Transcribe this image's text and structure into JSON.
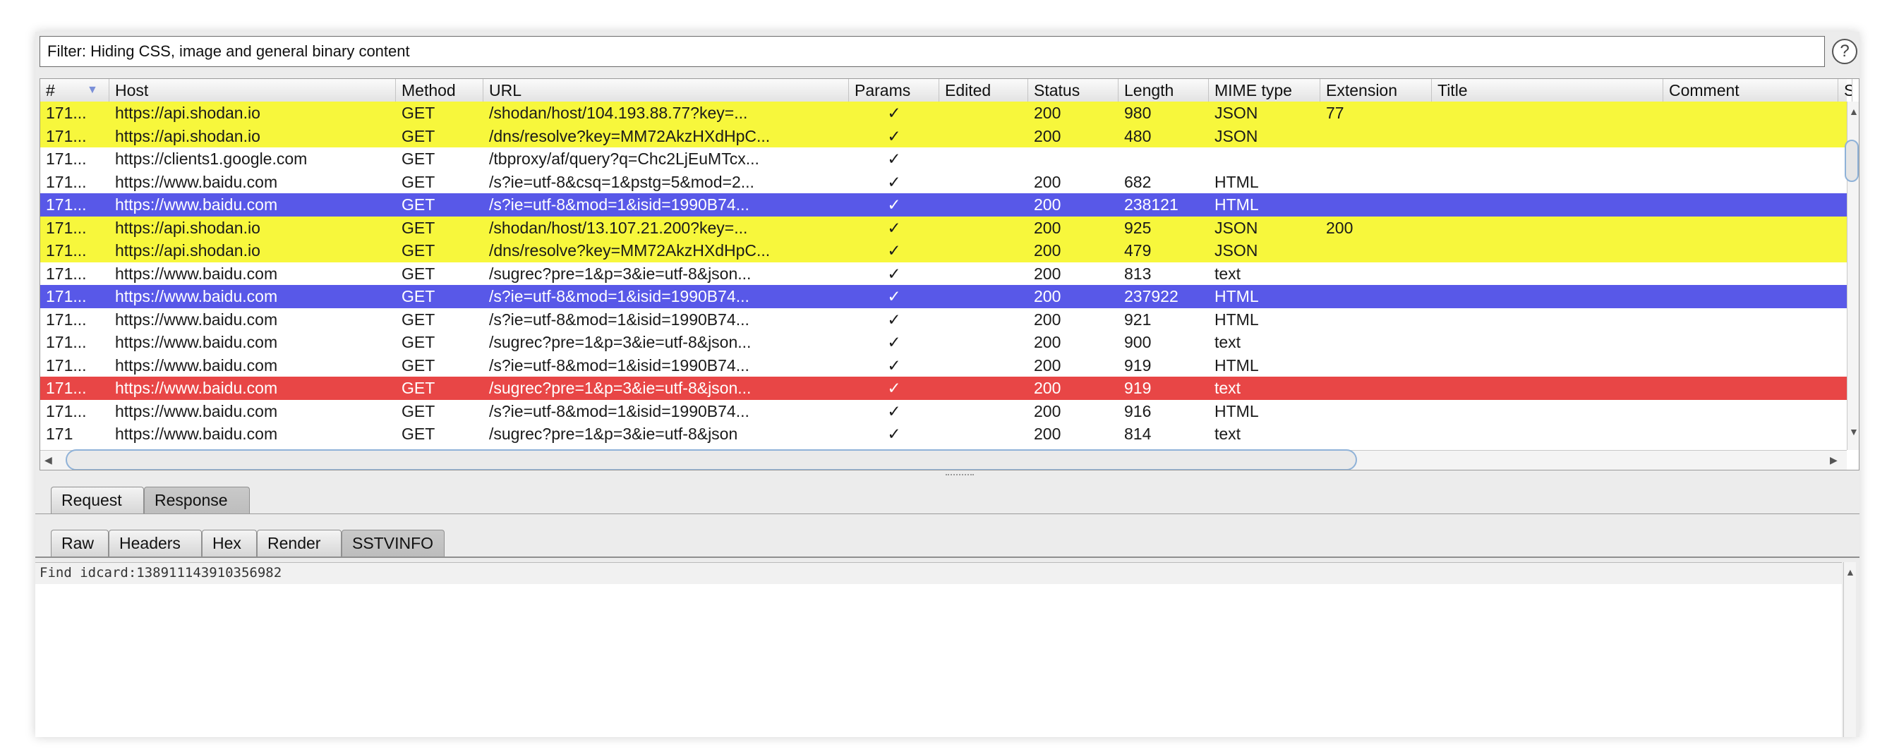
{
  "filter": {
    "text": "Filter: Hiding CSS, image and general binary content",
    "help_glyph": "?"
  },
  "columns": [
    "#",
    "Host",
    "Method",
    "URL",
    "Params",
    "Edited",
    "Status",
    "Length",
    "MIME type",
    "Extension",
    "Title",
    "Comment",
    "S"
  ],
  "check_glyph": "✓",
  "rows": [
    {
      "color": "yellow",
      "num": "171...",
      "host": "https://api.shodan.io",
      "method": "GET",
      "url": "/shodan/host/104.193.88.77?key=...",
      "params": "✓",
      "edited": "",
      "status": "200",
      "length": "980",
      "mime": "JSON",
      "ext": "77",
      "title": "",
      "comment": ""
    },
    {
      "color": "yellow",
      "num": "171...",
      "host": "https://api.shodan.io",
      "method": "GET",
      "url": "/dns/resolve?key=MM72AkzHXdHpC...",
      "params": "✓",
      "edited": "",
      "status": "200",
      "length": "480",
      "mime": "JSON",
      "ext": "",
      "title": "",
      "comment": ""
    },
    {
      "color": "white",
      "num": "171...",
      "host": "https://clients1.google.com",
      "method": "GET",
      "url": "/tbproxy/af/query?q=Chc2LjEuMTcx...",
      "params": "✓",
      "edited": "",
      "status": "",
      "length": "",
      "mime": "",
      "ext": "",
      "title": "",
      "comment": ""
    },
    {
      "color": "white",
      "num": "171...",
      "host": "https://www.baidu.com",
      "method": "GET",
      "url": "/s?ie=utf-8&csq=1&pstg=5&mod=2...",
      "params": "✓",
      "edited": "",
      "status": "200",
      "length": "682",
      "mime": "HTML",
      "ext": "",
      "title": "",
      "comment": ""
    },
    {
      "color": "blue",
      "num": "171...",
      "host": "https://www.baidu.com",
      "method": "GET",
      "url": "/s?ie=utf-8&mod=1&isid=1990B74...",
      "params": "✓",
      "edited": "",
      "status": "200",
      "length": "238121",
      "mime": "HTML",
      "ext": "",
      "title": "",
      "comment": ""
    },
    {
      "color": "yellow",
      "num": "171...",
      "host": "https://api.shodan.io",
      "method": "GET",
      "url": "/shodan/host/13.107.21.200?key=...",
      "params": "✓",
      "edited": "",
      "status": "200",
      "length": "925",
      "mime": "JSON",
      "ext": "200",
      "title": "",
      "comment": ""
    },
    {
      "color": "yellow",
      "num": "171...",
      "host": "https://api.shodan.io",
      "method": "GET",
      "url": "/dns/resolve?key=MM72AkzHXdHpC...",
      "params": "✓",
      "edited": "",
      "status": "200",
      "length": "479",
      "mime": "JSON",
      "ext": "",
      "title": "",
      "comment": ""
    },
    {
      "color": "white",
      "num": "171...",
      "host": "https://www.baidu.com",
      "method": "GET",
      "url": "/sugrec?pre=1&p=3&ie=utf-8&json...",
      "params": "✓",
      "edited": "",
      "status": "200",
      "length": "813",
      "mime": "text",
      "ext": "",
      "title": "",
      "comment": ""
    },
    {
      "color": "blue",
      "num": "171...",
      "host": "https://www.baidu.com",
      "method": "GET",
      "url": "/s?ie=utf-8&mod=1&isid=1990B74...",
      "params": "✓",
      "edited": "",
      "status": "200",
      "length": "237922",
      "mime": "HTML",
      "ext": "",
      "title": "",
      "comment": ""
    },
    {
      "color": "white",
      "num": "171...",
      "host": "https://www.baidu.com",
      "method": "GET",
      "url": "/s?ie=utf-8&mod=1&isid=1990B74...",
      "params": "✓",
      "edited": "",
      "status": "200",
      "length": "921",
      "mime": "HTML",
      "ext": "",
      "title": "",
      "comment": ""
    },
    {
      "color": "white",
      "num": "171...",
      "host": "https://www.baidu.com",
      "method": "GET",
      "url": "/sugrec?pre=1&p=3&ie=utf-8&json...",
      "params": "✓",
      "edited": "",
      "status": "200",
      "length": "900",
      "mime": "text",
      "ext": "",
      "title": "",
      "comment": ""
    },
    {
      "color": "white",
      "num": "171...",
      "host": "https://www.baidu.com",
      "method": "GET",
      "url": "/s?ie=utf-8&mod=1&isid=1990B74...",
      "params": "✓",
      "edited": "",
      "status": "200",
      "length": "919",
      "mime": "HTML",
      "ext": "",
      "title": "",
      "comment": ""
    },
    {
      "color": "red",
      "num": "171...",
      "host": "https://www.baidu.com",
      "method": "GET",
      "url": "/sugrec?pre=1&p=3&ie=utf-8&json...",
      "params": "✓",
      "edited": "",
      "status": "200",
      "length": "919",
      "mime": "text",
      "ext": "",
      "title": "",
      "comment": ""
    },
    {
      "color": "white",
      "num": "171...",
      "host": "https://www.baidu.com",
      "method": "GET",
      "url": "/s?ie=utf-8&mod=1&isid=1990B74...",
      "params": "✓",
      "edited": "",
      "status": "200",
      "length": "916",
      "mime": "HTML",
      "ext": "",
      "title": "",
      "comment": ""
    },
    {
      "color": "white",
      "num": "171",
      "host": "https://www.baidu.com",
      "method": "GET",
      "url": "/sugrec?pre=1&p=3&ie=utf-8&json",
      "params": "✓",
      "edited": "",
      "status": "200",
      "length": "814",
      "mime": "text",
      "ext": "",
      "title": "",
      "comment": ""
    }
  ],
  "row_colors": {
    "white": "#ffffff",
    "yellow": "#f7f73c",
    "blue": "#5858e8",
    "red": "#e84646"
  },
  "message_tabs": [
    "Request",
    "Response"
  ],
  "message_tab_selected": "Response",
  "view_tabs": [
    "Raw",
    "Headers",
    "Hex",
    "Render",
    "SSTVINFO"
  ],
  "view_tab_selected": "SSTVINFO",
  "response": {
    "text": "Find idcard:138911143910356982"
  }
}
